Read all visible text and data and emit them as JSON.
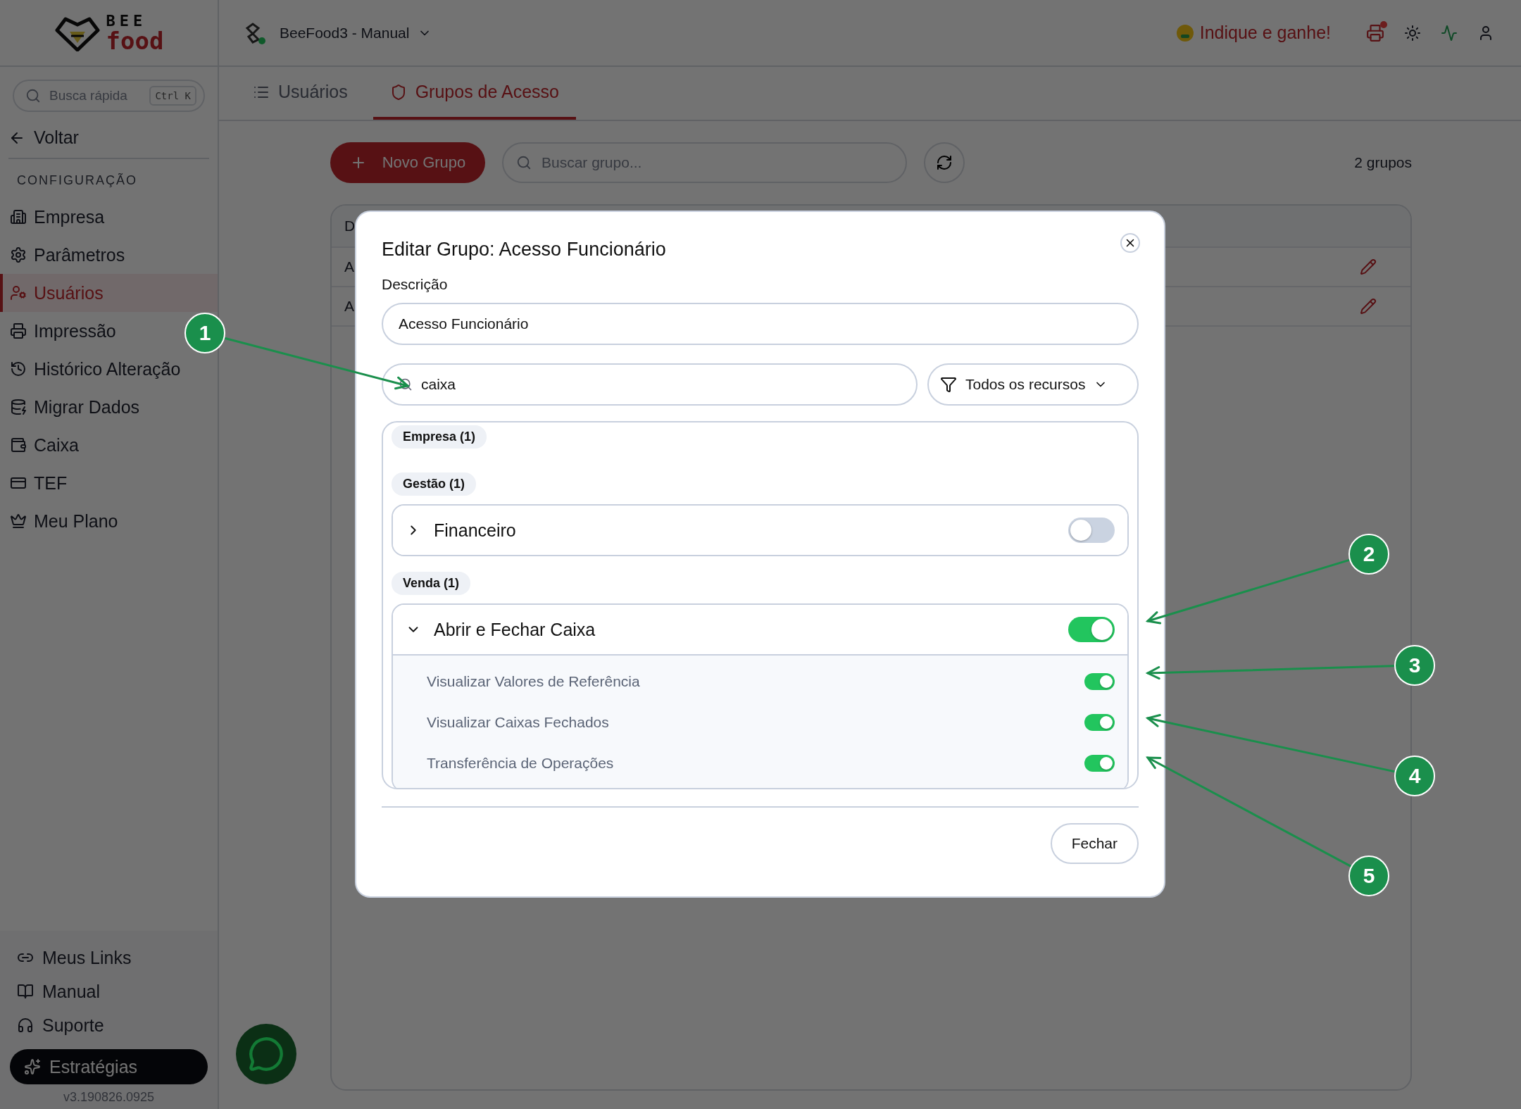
{
  "logo": {
    "top": "BEE",
    "bottom": "food"
  },
  "sidebar": {
    "search": {
      "placeholder": "Busca rápida",
      "shortcut": "Ctrl K"
    },
    "back": "Voltar",
    "section": "CONFIGURAÇÃO",
    "items": [
      {
        "kind": "building",
        "label": "Empresa",
        "selected": false
      },
      {
        "kind": "gear",
        "label": "Parâmetros",
        "selected": false
      },
      {
        "kind": "users",
        "label": "Usuários",
        "selected": true
      },
      {
        "kind": "printer",
        "label": "Impressão",
        "selected": false
      },
      {
        "kind": "history",
        "label": "Histórico Alteração",
        "selected": false
      },
      {
        "kind": "database",
        "label": "Migrar Dados",
        "selected": false
      },
      {
        "kind": "wallet",
        "label": "Caixa",
        "selected": false
      },
      {
        "kind": "card",
        "label": "TEF",
        "selected": false
      },
      {
        "kind": "crown",
        "label": "Meu Plano",
        "selected": false
      }
    ],
    "footer_links": [
      {
        "kind": "link",
        "label": "Meus Links"
      },
      {
        "kind": "book",
        "label": "Manual"
      },
      {
        "kind": "headphones",
        "label": "Suporte"
      }
    ],
    "cta": "Estratégias",
    "version": "v3.190826.0925"
  },
  "topbar": {
    "project": "BeeFood3 - Manual",
    "referral": "Indique e ganhe!",
    "printer_alert": true
  },
  "tabs": [
    {
      "label": "Usuários",
      "selected": false
    },
    {
      "label": "Grupos de Acesso",
      "selected": true
    }
  ],
  "toolbar": {
    "new_button": "Novo Grupo",
    "search": {
      "placeholder": "Buscar grupo..."
    },
    "count": "2 grupos"
  },
  "table": {
    "header": "D",
    "rows": [
      "A",
      "A"
    ]
  },
  "dialog": {
    "title": "Editar Grupo: Acesso Funcionário",
    "description_label": "Descrição",
    "description_value": "Acesso Funcionário",
    "search_value": "caixa",
    "filter": "Todos os recursos",
    "groups": [
      {
        "label": "Empresa (1)"
      },
      {
        "label": "Gestão (1)",
        "permissions": [
          {
            "name": "Financeiro",
            "on": false,
            "expanded": false
          }
        ]
      },
      {
        "label": "Venda (1)",
        "permissions": [
          {
            "name": "Abrir e Fechar Caixa",
            "on": true,
            "expanded": true,
            "children": [
              {
                "name": "Visualizar Valores de Referência",
                "on": true
              },
              {
                "name": "Visualizar Caixas Fechados",
                "on": true
              },
              {
                "name": "Transferência de Operações",
                "on": true
              }
            ]
          }
        ]
      }
    ],
    "close_button": "Fechar"
  },
  "annotations": [
    {
      "label": "1"
    },
    {
      "label": "2"
    },
    {
      "label": "3"
    },
    {
      "label": "4"
    },
    {
      "label": "5"
    }
  ]
}
